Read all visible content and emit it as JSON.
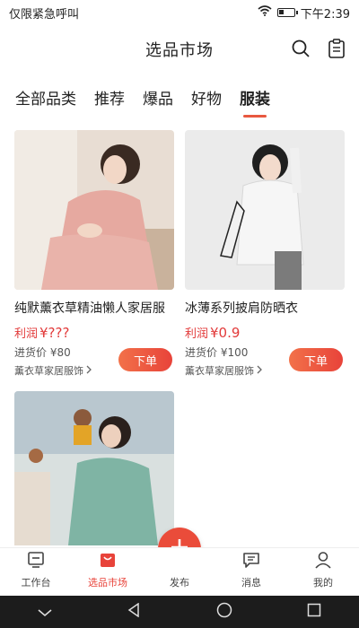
{
  "status_bar": {
    "left_text": "仅限紧急呼叫",
    "time": "下午2:39",
    "battery_level": 0.35
  },
  "header": {
    "title": "选品市场",
    "icons": [
      "search-icon",
      "clipboard-icon"
    ]
  },
  "tabs": [
    {
      "label": "全部品类"
    },
    {
      "label": "推荐"
    },
    {
      "label": "爆品"
    },
    {
      "label": "好物"
    },
    {
      "label": "服装",
      "active": true
    }
  ],
  "products": [
    {
      "title": "纯默薰衣草精油懒人家居服",
      "profit_label": "利润",
      "profit": "¥???",
      "cost": "进货价 ¥80",
      "store": "薰衣草家居服饰",
      "order_label": "下单"
    },
    {
      "title": "冰薄系列披肩防晒衣",
      "profit_label": "利润",
      "profit": "¥0.9",
      "cost": "进货价 ¥100",
      "store": "薰衣草家居服饰",
      "order_label": "下单"
    },
    {
      "title": ""
    }
  ],
  "bottom_nav": [
    {
      "label": "工作台",
      "icon": "workbench-icon"
    },
    {
      "label": "选品市场",
      "icon": "market-bag-icon",
      "active": true
    },
    {
      "label": "发布",
      "icon": "plus-icon"
    },
    {
      "label": "消息",
      "icon": "message-icon"
    },
    {
      "label": "我的",
      "icon": "profile-icon"
    }
  ],
  "colors": {
    "accent": "#e8433a",
    "profit": "#e23a3a"
  }
}
